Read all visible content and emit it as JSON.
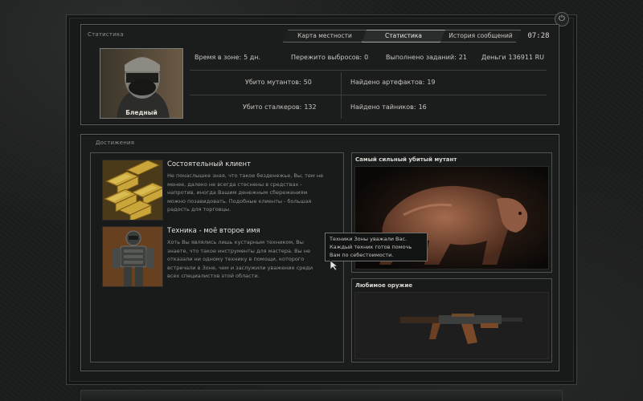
{
  "window": {
    "power_icon": "power-icon",
    "clock": "07:28"
  },
  "tabs": [
    {
      "label": "Карта местности",
      "active": false
    },
    {
      "label": "Статистика",
      "active": true
    },
    {
      "label": "История сообщений",
      "active": false
    }
  ],
  "stats_panel": {
    "label": "Статистика",
    "player_name": "Бледный",
    "rows": {
      "time_in_zone": {
        "label": "Время в зоне:",
        "value": "5 дн."
      },
      "emissions": {
        "label": "Пережито выбросов:",
        "value": "0"
      },
      "tasks": {
        "label": "Выполнено заданий:",
        "value": "21"
      },
      "money": {
        "label": "Деньги",
        "value": "136911 RU"
      },
      "mutants": {
        "label": "Убито мутантов:",
        "value": "50"
      },
      "artifacts": {
        "label": "Найдено артефактов:",
        "value": "19"
      },
      "stalkers": {
        "label": "Убито сталкеров:",
        "value": "132"
      },
      "stashes": {
        "label": "Найдено тайников:",
        "value": "16"
      }
    }
  },
  "achievements_panel": {
    "label": "Достижения",
    "items": [
      {
        "title": "Состоятельный клиент",
        "description": "Не понаслышке зная, что такое безденежье, Вы, тем не менее, далеко не всегда стеснены в средствах - напротив, иногда Вашим денежным сбережениям можно позавидовать. Подобные клиенты - большая радость для торговцы.",
        "icon": "gold-bars-image"
      },
      {
        "title": "Техника - моё второе имя",
        "description": "Хоть Вы являлись лишь кустарным техником, Вы знаете, что такое инструменты для мастера. Вы не отказали ни одному технику в помощи, которого встречали в Зоне, чем и заслужили уважение среди всех специалистов этой области.",
        "icon": "exoskeleton-suit-image"
      }
    ],
    "strongest_mutant_label": "Самый сильный убитый мутант",
    "favorite_weapon_label": "Любимое оружие"
  },
  "tooltip": {
    "lines": [
      "Техники Зоны уважали Вас.",
      "Каждый техник готов помочь",
      "Вам по себестоимости."
    ]
  }
}
